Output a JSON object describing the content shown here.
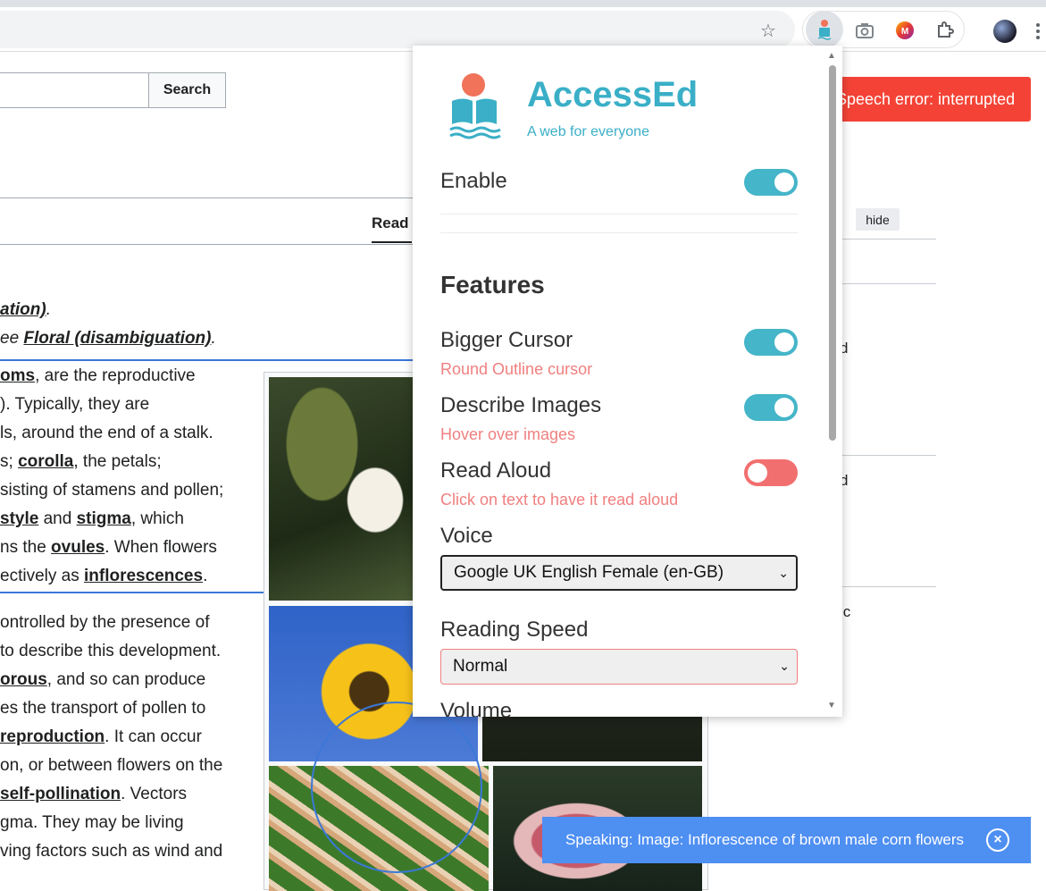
{
  "browser": {
    "star_icon": "☆",
    "camera_icon": "camera",
    "extensions_icon": "puzzle"
  },
  "wiki": {
    "search_button": "Search",
    "read_tab": "Read",
    "hide_button": "hide",
    "hatnote1": "ation)",
    "hatnote1_end": ".",
    "hatnote2_prefix": "ee ",
    "hatnote2_link": "Floral (disambiguation)",
    "hatnote2_end": ".",
    "para1": [
      {
        "b": "oms",
        "t": ", are the reproductive"
      },
      {
        "t": "). Typically, they are"
      },
      {
        "t": "ls, around the end of a stalk."
      },
      {
        "t": "s; ",
        "b": "corolla",
        "t2": ", the petals;"
      },
      {
        "t": "sisting of stamens and pollen;"
      },
      {
        "t": " ",
        "b": "style",
        "t2": " and ",
        "b2": "stigma",
        "t3": ", which"
      },
      {
        "t": "ns the ",
        "b": "ovules",
        "t2": ". When flowers"
      },
      {
        "t": "ectively as ",
        "b": "inflorescences",
        "t2": "."
      }
    ],
    "para2": [
      {
        "t": "ontrolled by the presence of"
      },
      {
        "t": "to describe this development."
      },
      {
        "b": "orous",
        "t": ", and so can produce"
      },
      {
        "t": "es the transport of pollen to"
      },
      {
        "b": " reproduction",
        "t": ". It can occur"
      },
      {
        "t": "on, or between flowers on the"
      },
      {
        "b": "self-pollination",
        "t": ". Vectors"
      },
      {
        "t": "gma. They may be living"
      },
      {
        "t": "ving factors such as wind and"
      }
    ],
    "right_fragments": [
      "d",
      "d",
      "ic"
    ]
  },
  "toasts": {
    "error": "Speech error: interrupted",
    "speaking": "Speaking: Image: Inflorescence of brown male corn flowers",
    "close_icon": "×"
  },
  "popup": {
    "title": "AccessEd",
    "subtitle": "A web for everyone",
    "enable_label": "Enable",
    "features_heading": "Features",
    "features": [
      {
        "label": "Bigger Cursor",
        "hint": "Round Outline cursor",
        "state": "on"
      },
      {
        "label": "Describe Images",
        "hint": "Hover over images",
        "state": "on"
      },
      {
        "label": "Read Aloud",
        "hint": "Click on text to have it read aloud",
        "state": "off"
      }
    ],
    "voice_label": "Voice",
    "voice_value": "Google UK English Female (en-GB)",
    "speed_label": "Reading Speed",
    "speed_value": "Normal",
    "volume_label": "Volume",
    "colors": {
      "accent": "#3aafc7",
      "hint": "#f07f7f",
      "toggle_on": "#45b5c9",
      "toggle_off": "#f26f6f"
    }
  }
}
